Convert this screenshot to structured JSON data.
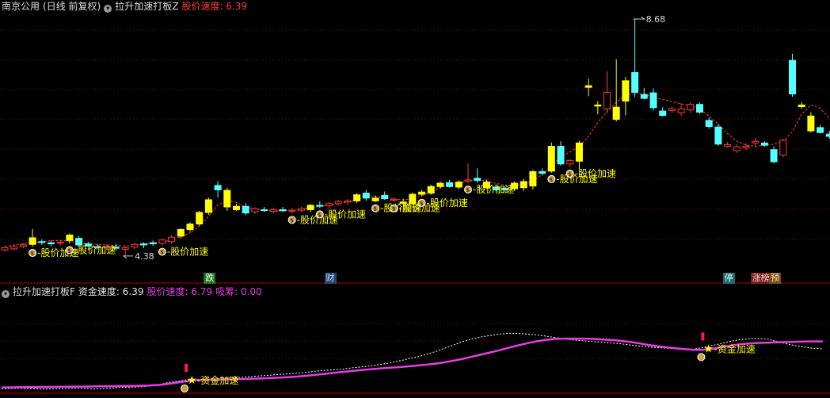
{
  "header_top": {
    "stock": "南京公用",
    "period": "(日线 前复权)",
    "indicator": "拉升加速打板Z",
    "speed_label": "股价速度: 6.39"
  },
  "header_bottom": {
    "indicator": "拉升加速打板F",
    "fund_speed": "资金速度: 6.39",
    "price_speed": "股价速度: 6.79",
    "absorb": "吸筹: 0.00"
  },
  "annotations": {
    "price_high": "8.68",
    "price_low": "4.38",
    "price_accel": "股价加速",
    "fund_accel": "资金加速"
  },
  "tags": [
    {
      "text": "跌",
      "bg": "#1f7a1f",
      "fg": "#ffffff"
    },
    {
      "text": "财",
      "bg": "#26476b",
      "fg": "#bcd8ff"
    },
    {
      "text": "停",
      "bg": "#1f6b6b",
      "fg": "#dfffff"
    },
    {
      "text": "涨榜",
      "bg": "#7a1f1f",
      "fg": "#ffd0d0"
    },
    {
      "text": "预",
      "bg": "#7a4a1f",
      "fg": "#ffe0b0"
    }
  ],
  "colors": {
    "up": "#ff3b3b",
    "down": "#54ffff",
    "accel": "#ffff00",
    "speed_line": "#e63de6",
    "dotted_line": "#ffffff",
    "grid": "#8b0000"
  },
  "chart_data": [
    {
      "type": "candlestick",
      "title": "拉升加速打板Z",
      "annotations_high": 8.68,
      "annotations_low": 4.38,
      "candles": [
        {
          "o": 4.49,
          "h": 4.54,
          "l": 4.46,
          "c": 4.53,
          "k": "up"
        },
        {
          "o": 4.51,
          "h": 4.57,
          "l": 4.48,
          "c": 4.55,
          "k": "up"
        },
        {
          "o": 4.55,
          "h": 4.61,
          "l": 4.52,
          "c": 4.58,
          "k": "up"
        },
        {
          "o": 4.59,
          "h": 4.87,
          "l": 4.55,
          "c": 4.71,
          "k": "accel"
        },
        {
          "o": 4.64,
          "h": 4.68,
          "l": 4.58,
          "c": 4.64,
          "k": "down"
        },
        {
          "o": 4.6,
          "h": 4.66,
          "l": 4.56,
          "c": 4.62,
          "k": "down"
        },
        {
          "o": 4.62,
          "h": 4.67,
          "l": 4.57,
          "c": 4.63,
          "k": "up"
        },
        {
          "o": 4.66,
          "h": 4.79,
          "l": 4.6,
          "c": 4.76,
          "k": "accel"
        },
        {
          "o": 4.7,
          "h": 4.74,
          "l": 4.55,
          "c": 4.58,
          "k": "down"
        },
        {
          "o": 4.6,
          "h": 4.64,
          "l": 4.54,
          "c": 4.56,
          "k": "down"
        },
        {
          "o": 4.55,
          "h": 4.6,
          "l": 4.5,
          "c": 4.54,
          "k": "down"
        },
        {
          "o": 4.54,
          "h": 4.59,
          "l": 4.49,
          "c": 4.55,
          "k": "up"
        },
        {
          "o": 4.54,
          "h": 4.6,
          "l": 4.47,
          "c": 4.52,
          "k": "down"
        },
        {
          "o": 4.5,
          "h": 4.56,
          "l": 4.38,
          "c": 4.53,
          "k": "up"
        },
        {
          "o": 4.54,
          "h": 4.62,
          "l": 4.5,
          "c": 4.59,
          "k": "up"
        },
        {
          "o": 4.58,
          "h": 4.63,
          "l": 4.52,
          "c": 4.6,
          "k": "down"
        },
        {
          "o": 4.6,
          "h": 4.66,
          "l": 4.56,
          "c": 4.62,
          "k": "down"
        },
        {
          "o": 4.61,
          "h": 4.7,
          "l": 4.57,
          "c": 4.67,
          "k": "up"
        },
        {
          "o": 4.64,
          "h": 4.76,
          "l": 4.6,
          "c": 4.72,
          "k": "up"
        },
        {
          "o": 4.74,
          "h": 4.88,
          "l": 4.7,
          "c": 4.86,
          "k": "accel"
        },
        {
          "o": 4.86,
          "h": 4.99,
          "l": 4.82,
          "c": 4.96,
          "k": "accel"
        },
        {
          "o": 4.96,
          "h": 5.2,
          "l": 4.93,
          "c": 5.17,
          "k": "accel"
        },
        {
          "o": 5.17,
          "h": 5.44,
          "l": 5.13,
          "c": 5.4,
          "k": "accel"
        },
        {
          "o": 5.58,
          "h": 5.74,
          "l": 5.44,
          "c": 5.66,
          "k": "down"
        },
        {
          "o": 5.57,
          "h": 5.62,
          "l": 5.2,
          "c": 5.27,
          "k": "accel"
        },
        {
          "o": 5.28,
          "h": 5.33,
          "l": 5.2,
          "c": 5.22,
          "k": "accel"
        },
        {
          "o": 5.28,
          "h": 5.34,
          "l": 5.12,
          "c": 5.16,
          "k": "down"
        },
        {
          "o": 5.18,
          "h": 5.26,
          "l": 5.14,
          "c": 5.24,
          "k": "up"
        },
        {
          "o": 5.22,
          "h": 5.27,
          "l": 5.18,
          "c": 5.21,
          "k": "down"
        },
        {
          "o": 5.19,
          "h": 5.25,
          "l": 5.15,
          "c": 5.22,
          "k": "up"
        },
        {
          "o": 5.22,
          "h": 5.27,
          "l": 5.18,
          "c": 5.2,
          "k": "down"
        },
        {
          "o": 5.2,
          "h": 5.25,
          "l": 5.15,
          "c": 5.21,
          "k": "up"
        },
        {
          "o": 5.21,
          "h": 5.27,
          "l": 5.18,
          "c": 5.24,
          "k": "up"
        },
        {
          "o": 5.22,
          "h": 5.32,
          "l": 5.17,
          "c": 5.3,
          "k": "accel"
        },
        {
          "o": 5.3,
          "h": 5.37,
          "l": 5.25,
          "c": 5.3,
          "k": "down"
        },
        {
          "o": 5.29,
          "h": 5.36,
          "l": 5.24,
          "c": 5.33,
          "k": "up"
        },
        {
          "o": 5.33,
          "h": 5.4,
          "l": 5.29,
          "c": 5.37,
          "k": "up"
        },
        {
          "o": 5.36,
          "h": 5.41,
          "l": 5.31,
          "c": 5.38,
          "k": "up"
        },
        {
          "o": 5.38,
          "h": 5.52,
          "l": 5.34,
          "c": 5.49,
          "k": "accel"
        },
        {
          "o": 5.52,
          "h": 5.58,
          "l": 5.38,
          "c": 5.43,
          "k": "down"
        },
        {
          "o": 5.43,
          "h": 5.48,
          "l": 5.36,
          "c": 5.38,
          "k": "accel"
        },
        {
          "o": 5.48,
          "h": 5.55,
          "l": 5.4,
          "c": 5.42,
          "k": "down"
        },
        {
          "o": 5.4,
          "h": 5.45,
          "l": 5.36,
          "c": 5.41,
          "k": "up"
        },
        {
          "o": 5.36,
          "h": 5.42,
          "l": 5.32,
          "c": 5.33,
          "k": "accel"
        },
        {
          "o": 5.33,
          "h": 5.53,
          "l": 5.31,
          "c": 5.5,
          "k": "accel"
        },
        {
          "o": 5.5,
          "h": 5.58,
          "l": 5.46,
          "c": 5.54,
          "k": "accel"
        },
        {
          "o": 5.52,
          "h": 5.67,
          "l": 5.49,
          "c": 5.64,
          "k": "accel"
        },
        {
          "o": 5.64,
          "h": 5.73,
          "l": 5.6,
          "c": 5.7,
          "k": "accel"
        },
        {
          "o": 5.71,
          "h": 5.76,
          "l": 5.62,
          "c": 5.64,
          "k": "down"
        },
        {
          "o": 5.63,
          "h": 5.75,
          "l": 5.59,
          "c": 5.72,
          "k": "accel"
        },
        {
          "o": 5.74,
          "h": 6.06,
          "l": 5.7,
          "c": 5.76,
          "k": "up"
        },
        {
          "o": 5.75,
          "h": 5.97,
          "l": 5.71,
          "c": 5.79,
          "k": "down"
        },
        {
          "o": 5.72,
          "h": 5.77,
          "l": 5.6,
          "c": 5.62,
          "k": "accel"
        },
        {
          "o": 5.63,
          "h": 5.68,
          "l": 5.55,
          "c": 5.58,
          "k": "down"
        },
        {
          "o": 5.58,
          "h": 5.64,
          "l": 5.53,
          "c": 5.61,
          "k": "down"
        },
        {
          "o": 5.6,
          "h": 5.73,
          "l": 5.56,
          "c": 5.7,
          "k": "accel"
        },
        {
          "o": 5.62,
          "h": 5.78,
          "l": 5.56,
          "c": 5.73,
          "k": "accel"
        },
        {
          "o": 5.65,
          "h": 5.94,
          "l": 5.59,
          "c": 5.91,
          "k": "accel"
        },
        {
          "o": 5.91,
          "h": 5.97,
          "l": 5.84,
          "c": 5.88,
          "k": "down"
        },
        {
          "o": 5.92,
          "h": 6.44,
          "l": 5.89,
          "c": 6.37,
          "k": "accel"
        },
        {
          "o": 6.37,
          "h": 6.46,
          "l": 6.02,
          "c": 6.05,
          "k": "down"
        },
        {
          "o": 6.05,
          "h": 6.14,
          "l": 5.99,
          "c": 6.11,
          "k": "up"
        },
        {
          "o": 6.1,
          "h": 6.47,
          "l": 5.96,
          "c": 6.43,
          "k": "accel"
        },
        {
          "o": 7.47,
          "h": 7.6,
          "l": 7.28,
          "c": 7.44,
          "k": "accel"
        },
        {
          "o": 7.12,
          "h": 7.19,
          "l": 6.95,
          "c": 7.1,
          "k": "accel"
        },
        {
          "o": 7.35,
          "h": 7.73,
          "l": 6.97,
          "c": 7.05,
          "k": "up"
        },
        {
          "o": 7.08,
          "h": 7.95,
          "l": 6.82,
          "c": 6.86,
          "k": "accel"
        },
        {
          "o": 7.19,
          "h": 7.63,
          "l": 6.93,
          "c": 7.56,
          "k": "accel"
        },
        {
          "o": 7.71,
          "h": 8.68,
          "l": 7.26,
          "c": 7.35,
          "k": "down"
        },
        {
          "o": 7.31,
          "h": 7.43,
          "l": 7.22,
          "c": 7.24,
          "k": "down"
        },
        {
          "o": 7.34,
          "h": 7.42,
          "l": 7.02,
          "c": 7.07,
          "k": "down"
        },
        {
          "o": 7.01,
          "h": 7.08,
          "l": 6.91,
          "c": 6.93,
          "k": "down"
        },
        {
          "o": 7.02,
          "h": 7.09,
          "l": 6.98,
          "c": 7.05,
          "k": "up"
        },
        {
          "o": 7.05,
          "h": 7.15,
          "l": 6.92,
          "c": 6.98,
          "k": "up"
        },
        {
          "o": 7.03,
          "h": 7.17,
          "l": 6.98,
          "c": 7.13,
          "k": "up"
        },
        {
          "o": 7.13,
          "h": 7.17,
          "l": 6.96,
          "c": 6.99,
          "k": "down"
        },
        {
          "o": 6.84,
          "h": 6.89,
          "l": 6.69,
          "c": 6.73,
          "k": "down"
        },
        {
          "o": 6.72,
          "h": 6.77,
          "l": 6.38,
          "c": 6.41,
          "k": "down"
        },
        {
          "o": 6.4,
          "h": 6.45,
          "l": 6.35,
          "c": 6.37,
          "k": "up"
        },
        {
          "o": 6.36,
          "h": 6.41,
          "l": 6.25,
          "c": 6.29,
          "k": "up"
        },
        {
          "o": 6.34,
          "h": 6.43,
          "l": 6.3,
          "c": 6.37,
          "k": "up"
        },
        {
          "o": 6.43,
          "h": 6.53,
          "l": 6.38,
          "c": 6.46,
          "k": "up"
        },
        {
          "o": 6.39,
          "h": 6.46,
          "l": 6.36,
          "c": 6.43,
          "k": "down"
        },
        {
          "o": 6.31,
          "h": 6.37,
          "l": 6.06,
          "c": 6.09,
          "k": "down"
        },
        {
          "o": 6.21,
          "h": 6.51,
          "l": 6.17,
          "c": 6.48,
          "k": "up"
        },
        {
          "o": 7.93,
          "h": 8.05,
          "l": 7.27,
          "c": 7.32,
          "k": "down"
        },
        {
          "o": 7.12,
          "h": 7.17,
          "l": 7.05,
          "c": 7.09,
          "k": "accel"
        },
        {
          "o": 6.92,
          "h": 6.99,
          "l": 6.62,
          "c": 6.65,
          "k": "accel"
        },
        {
          "o": 6.71,
          "h": 6.76,
          "l": 6.6,
          "c": 6.62,
          "k": "down"
        },
        {
          "o": 6.59,
          "h": 6.65,
          "l": 6.51,
          "c": 6.55,
          "k": "down"
        },
        {
          "o": 6.54,
          "h": 6.59,
          "l": 6.45,
          "c": 6.5,
          "k": "down"
        },
        {
          "o": 6.51,
          "h": 6.57,
          "l": 6.46,
          "c": 6.48,
          "k": "down"
        },
        {
          "o": 6.42,
          "h": 6.48,
          "l": 6.36,
          "c": 6.4,
          "k": "up"
        }
      ],
      "trail": [
        4.55,
        4.58,
        4.6,
        4.62,
        4.64,
        4.66,
        4.66,
        4.65,
        4.62,
        4.6,
        4.59,
        4.58,
        4.57,
        4.56,
        4.57,
        4.59,
        4.61,
        4.63,
        4.67,
        4.73,
        4.8,
        4.93,
        5.1,
        5.31,
        5.39,
        5.35,
        5.27,
        5.23,
        5.21,
        5.2,
        5.2,
        5.21,
        5.22,
        5.25,
        5.28,
        5.3,
        5.33,
        5.36,
        5.4,
        5.45,
        5.46,
        5.44,
        5.41,
        5.4,
        5.42,
        5.47,
        5.55,
        5.62,
        5.68,
        5.7,
        5.74,
        5.77,
        5.74,
        5.7,
        5.66,
        5.66,
        5.68,
        5.74,
        5.86,
        6.02,
        6.18,
        6.27,
        6.36,
        6.55,
        6.8,
        7.0,
        7.17,
        7.3,
        7.33,
        7.32,
        7.26,
        7.22,
        7.18,
        7.14,
        7.11,
        7.05,
        6.92,
        6.77,
        6.6,
        6.46,
        6.39,
        6.37,
        6.39,
        6.41,
        6.46,
        6.64,
        6.95,
        7.12,
        7.06,
        6.88,
        6.74,
        6.63,
        6.54,
        6.45
      ]
    },
    {
      "type": "line",
      "title": "拉升加速打板F",
      "series": [
        {
          "name": "资金速度",
          "values": [
            1.6,
            1.6,
            1.61,
            1.62,
            1.62,
            1.63,
            1.64,
            1.65,
            1.66,
            1.66,
            1.67,
            1.68,
            1.69,
            1.7,
            1.71,
            1.72,
            1.74,
            1.78,
            1.85,
            1.95,
            2.05,
            2.12,
            2.16,
            2.17,
            2.18,
            2.2,
            2.22,
            2.24,
            2.26,
            2.29,
            2.32,
            2.36,
            2.4,
            2.46,
            2.53,
            2.6,
            2.68,
            2.75,
            2.82,
            2.88,
            2.94,
            3.0,
            3.05,
            3.1,
            3.16,
            3.22,
            3.28,
            3.36,
            3.46,
            3.58,
            3.72,
            3.88,
            4.04,
            4.2,
            4.36,
            4.55,
            4.72,
            4.88,
            5.02,
            5.12,
            5.2,
            5.22,
            5.22,
            5.22,
            5.2,
            5.16,
            5.12,
            5.06,
            4.98,
            4.88,
            4.76,
            4.66,
            4.58,
            4.5,
            4.44,
            4.38,
            4.38,
            4.46,
            4.58,
            4.7,
            4.8,
            4.86,
            4.9,
            4.92,
            4.94,
            4.96,
            4.98,
            5.0,
            5.01,
            5.01
          ]
        },
        {
          "name": "股价速度",
          "values": [
            1.5,
            1.52,
            1.54,
            1.52,
            1.5,
            1.48,
            1.5,
            1.52,
            1.54,
            1.52,
            1.48,
            1.5,
            1.55,
            1.6,
            1.62,
            1.64,
            1.7,
            1.8,
            1.95,
            2.05,
            2.15,
            2.2,
            2.2,
            2.2,
            2.25,
            2.3,
            2.35,
            2.4,
            2.45,
            2.5,
            2.55,
            2.6,
            2.66,
            2.72,
            2.8,
            2.86,
            2.9,
            2.95,
            3.05,
            3.12,
            3.2,
            3.3,
            3.4,
            3.55,
            3.7,
            3.85,
            4.05,
            4.25,
            4.5,
            4.75,
            5.0,
            5.2,
            5.35,
            5.45,
            5.55,
            5.62,
            5.6,
            5.55,
            5.5,
            5.4,
            5.3,
            5.2,
            5.12,
            5.06,
            5.0,
            4.96,
            4.9,
            4.84,
            4.76,
            4.68,
            4.6,
            4.56,
            4.52,
            4.46,
            4.42,
            4.44,
            4.56,
            4.7,
            4.86,
            5.02,
            5.14,
            5.2,
            5.22,
            5.18,
            5.02,
            4.84,
            4.7,
            4.58,
            4.5,
            4.46
          ]
        }
      ],
      "markers": [
        {
          "index": 20,
          "label": "资金加速"
        },
        {
          "index": 76,
          "label": "资金加速"
        }
      ]
    }
  ]
}
